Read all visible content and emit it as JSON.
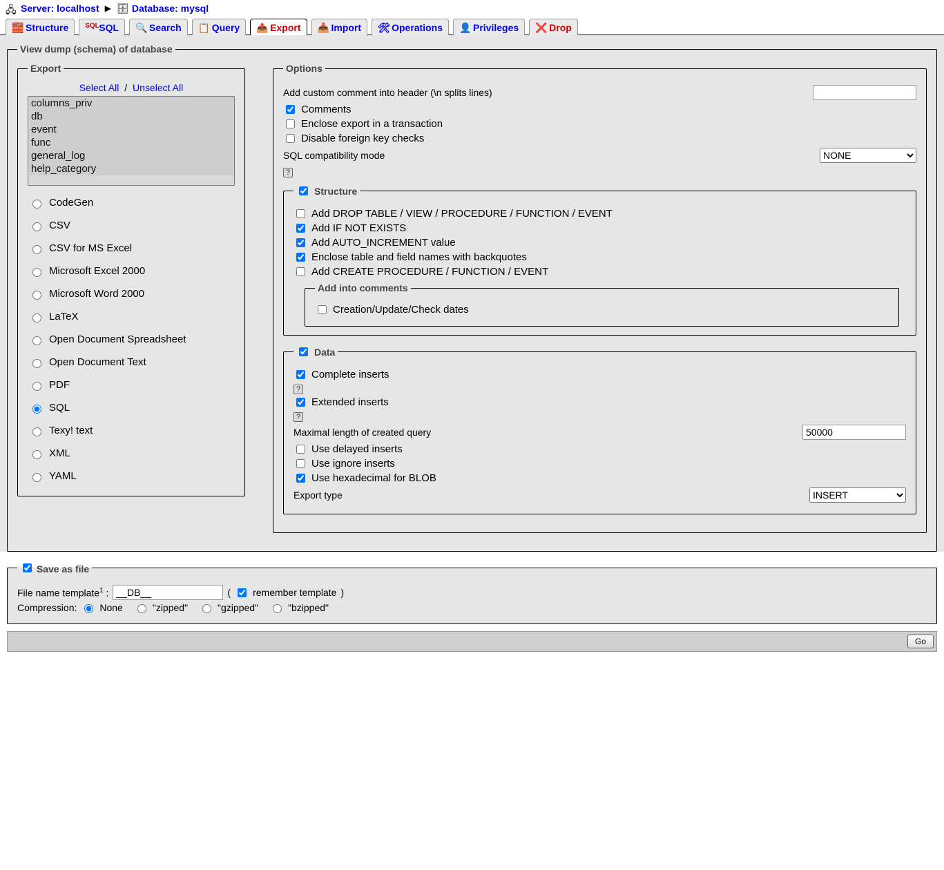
{
  "breadcrumb": {
    "server_label": "Server: localhost",
    "database_label": "Database: mysql"
  },
  "tabs": [
    {
      "id": "structure",
      "label": "Structure"
    },
    {
      "id": "sql",
      "label": "SQL"
    },
    {
      "id": "search",
      "label": "Search"
    },
    {
      "id": "query",
      "label": "Query"
    },
    {
      "id": "export",
      "label": "Export"
    },
    {
      "id": "import",
      "label": "Import"
    },
    {
      "id": "operations",
      "label": "Operations"
    },
    {
      "id": "privileges",
      "label": "Privileges"
    },
    {
      "id": "drop",
      "label": "Drop"
    }
  ],
  "main_legend": "View dump (schema) of database",
  "export_section": {
    "legend": "Export",
    "select_all": "Select All",
    "unselect_all": "Unselect All",
    "tables": [
      "columns_priv",
      "db",
      "event",
      "func",
      "general_log",
      "help_category"
    ],
    "formats": [
      "CodeGen",
      "CSV",
      "CSV for MS Excel",
      "Microsoft Excel 2000",
      "Microsoft Word 2000",
      "LaTeX",
      "Open Document Spreadsheet",
      "Open Document Text",
      "PDF",
      "SQL",
      "Texy! text",
      "XML",
      "YAML"
    ],
    "selected_format": "SQL"
  },
  "options_section": {
    "legend": "Options",
    "custom_comment_label": "Add custom comment into header (\\n splits lines)",
    "custom_comment_value": "",
    "comments": {
      "label": "Comments",
      "checked": true
    },
    "transaction": {
      "label": "Enclose export in a transaction",
      "checked": false
    },
    "fk": {
      "label": "Disable foreign key checks",
      "checked": false
    },
    "compat_label": "SQL compatibility mode",
    "compat_value": "NONE",
    "structure": {
      "legend": "Structure",
      "legend_checked": true,
      "drop": {
        "label": "Add DROP TABLE / VIEW / PROCEDURE / FUNCTION / EVENT",
        "checked": false
      },
      "ifnotexists": {
        "label": "Add IF NOT EXISTS",
        "checked": true
      },
      "autoinc": {
        "label": "Add AUTO_INCREMENT value",
        "checked": true
      },
      "backquotes": {
        "label": "Enclose table and field names with backquotes",
        "checked": true
      },
      "createproc": {
        "label": "Add CREATE PROCEDURE / FUNCTION / EVENT",
        "checked": false
      },
      "comments_sub": {
        "legend": "Add into comments",
        "dates": {
          "label": "Creation/Update/Check dates",
          "checked": false
        }
      }
    },
    "data": {
      "legend": "Data",
      "legend_checked": true,
      "complete": {
        "label": "Complete inserts",
        "checked": true
      },
      "extended": {
        "label": "Extended inserts",
        "checked": true
      },
      "maxlen_label": "Maximal length of created query",
      "maxlen_value": "50000",
      "delayed": {
        "label": "Use delayed inserts",
        "checked": false
      },
      "ignore": {
        "label": "Use ignore inserts",
        "checked": false
      },
      "hex": {
        "label": "Use hexadecimal for BLOB",
        "checked": true
      },
      "export_type_label": "Export type",
      "export_type_value": "INSERT"
    }
  },
  "save_file": {
    "legend": "Save as file",
    "legend_checked": true,
    "filename_label": "File name template",
    "filename_value": "__DB__",
    "remember_label": "remember template",
    "remember_checked": true,
    "compression_label": "Compression:",
    "options": [
      "None",
      "\"zipped\"",
      "\"gzipped\"",
      "\"bzipped\""
    ],
    "selected": "None"
  },
  "go_label": "Go"
}
